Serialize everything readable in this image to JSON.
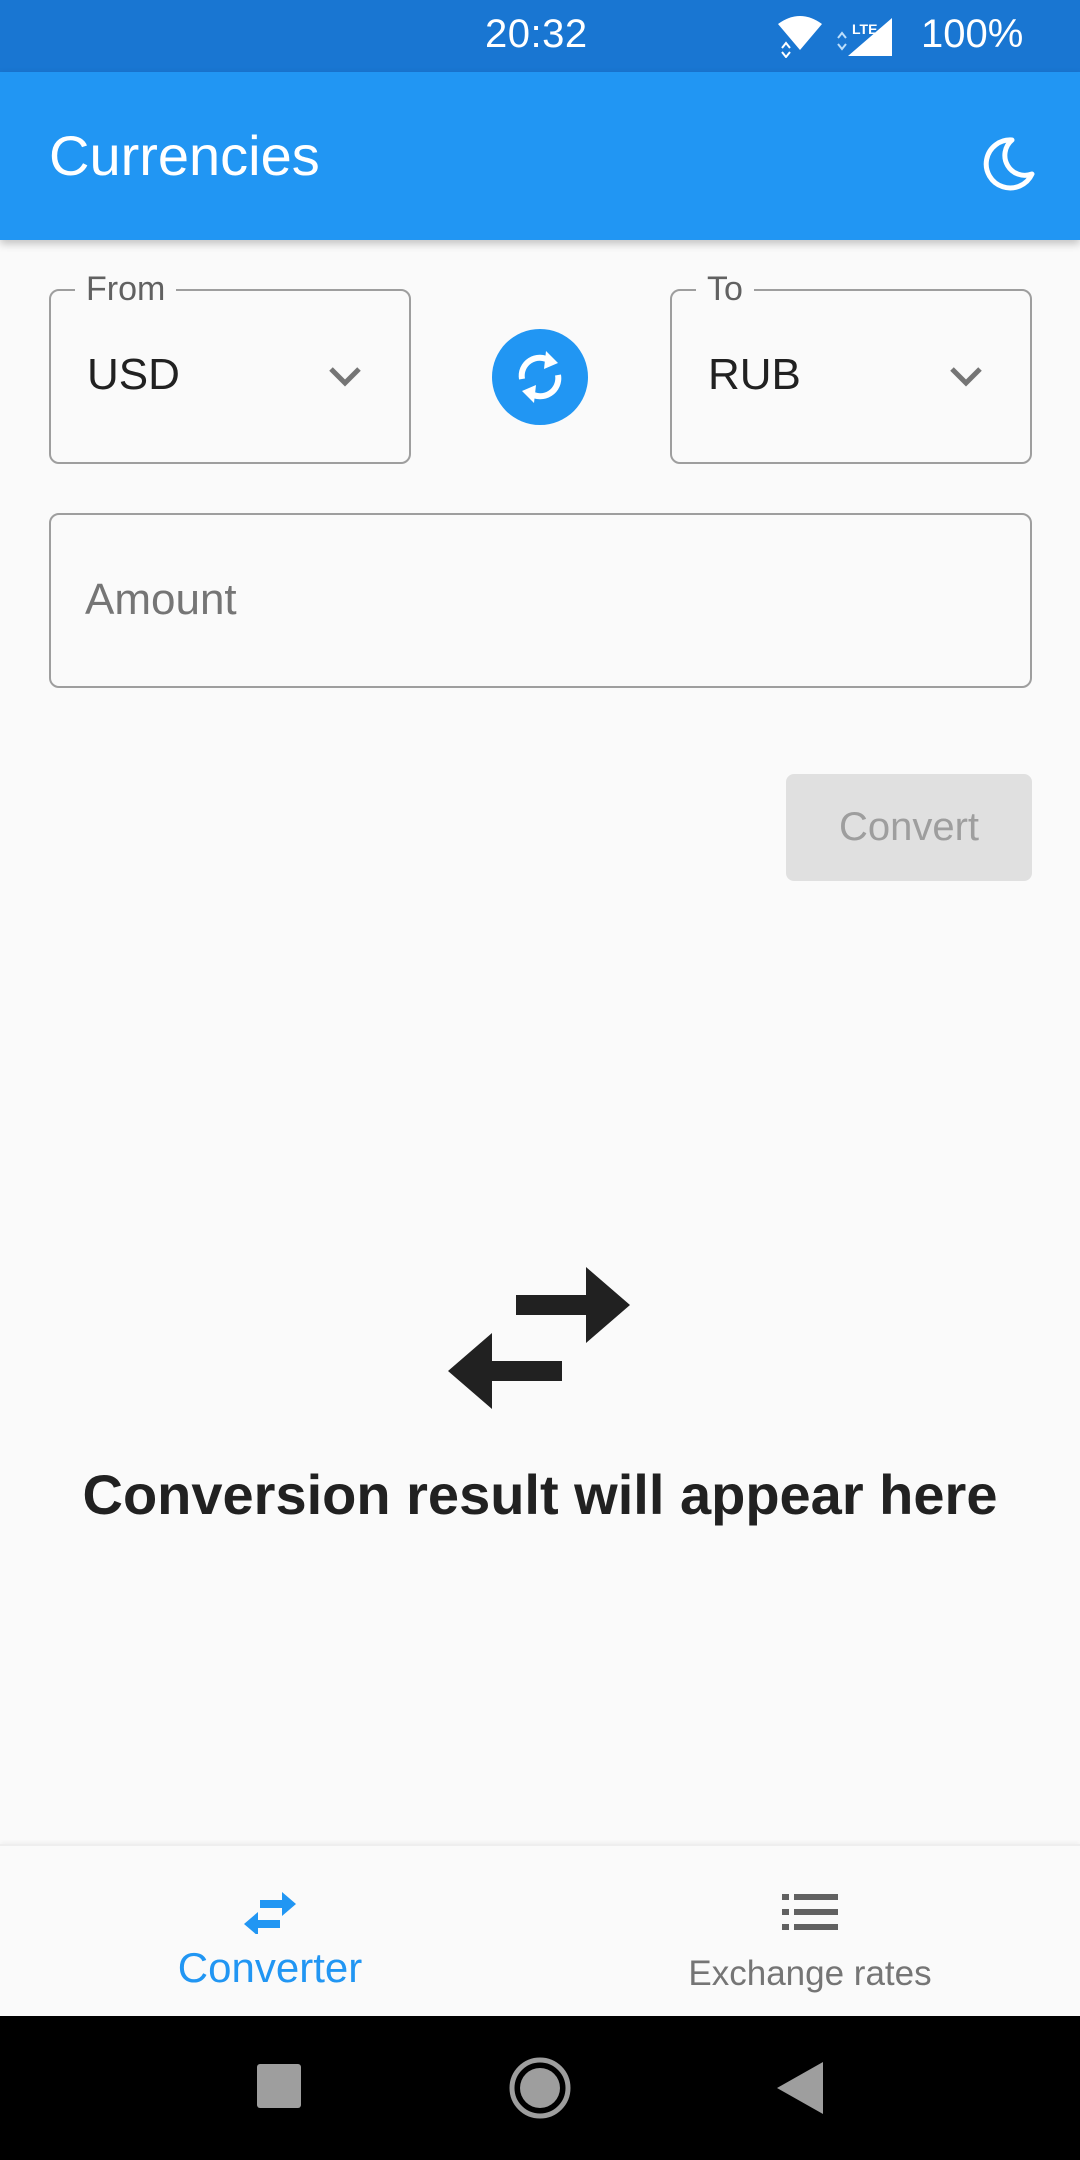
{
  "status_bar": {
    "time": "20:32",
    "battery": "100%",
    "network_label": "LTE"
  },
  "app_bar": {
    "title": "Currencies",
    "theme_toggle_icon": "moon-icon"
  },
  "converter": {
    "from": {
      "label": "From",
      "value": "USD"
    },
    "to": {
      "label": "To",
      "value": "RUB"
    },
    "swap_icon": "swap-circle-icon",
    "amount": {
      "placeholder": "Amount",
      "value": ""
    },
    "convert_label": "Convert",
    "convert_enabled": false,
    "result_icon": "swap-arrows-icon",
    "result_placeholder": "Conversion result will appear here"
  },
  "bottom_nav": {
    "items": [
      {
        "label": "Converter",
        "icon": "swap-arrows-icon",
        "selected": true
      },
      {
        "label": "Exchange rates",
        "icon": "list-icon",
        "selected": false
      }
    ]
  },
  "colors": {
    "primary": "#2196f3",
    "primary_dark": "#1976d2",
    "text": "#212121",
    "muted": "#757575",
    "disabled_bg": "#e0e0e0"
  }
}
